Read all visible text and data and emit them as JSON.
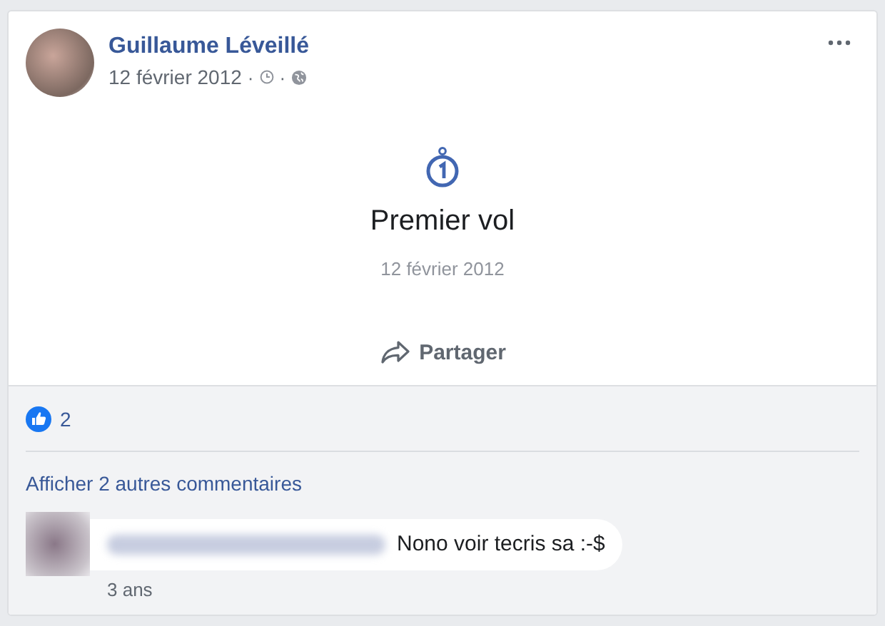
{
  "post": {
    "author": "Guillaume Léveillé",
    "date": "12 février 2012",
    "separator_1": "·",
    "separator_2": "·"
  },
  "event": {
    "title": "Premier vol",
    "date": "12 février 2012"
  },
  "share_button": {
    "label": "Partager"
  },
  "reactions": {
    "count": "2"
  },
  "comments": {
    "more_link": "Afficher 2 autres commentaires",
    "items": [
      {
        "text": "Nono voir tecris sa :-$",
        "age": "3 ans"
      }
    ]
  }
}
